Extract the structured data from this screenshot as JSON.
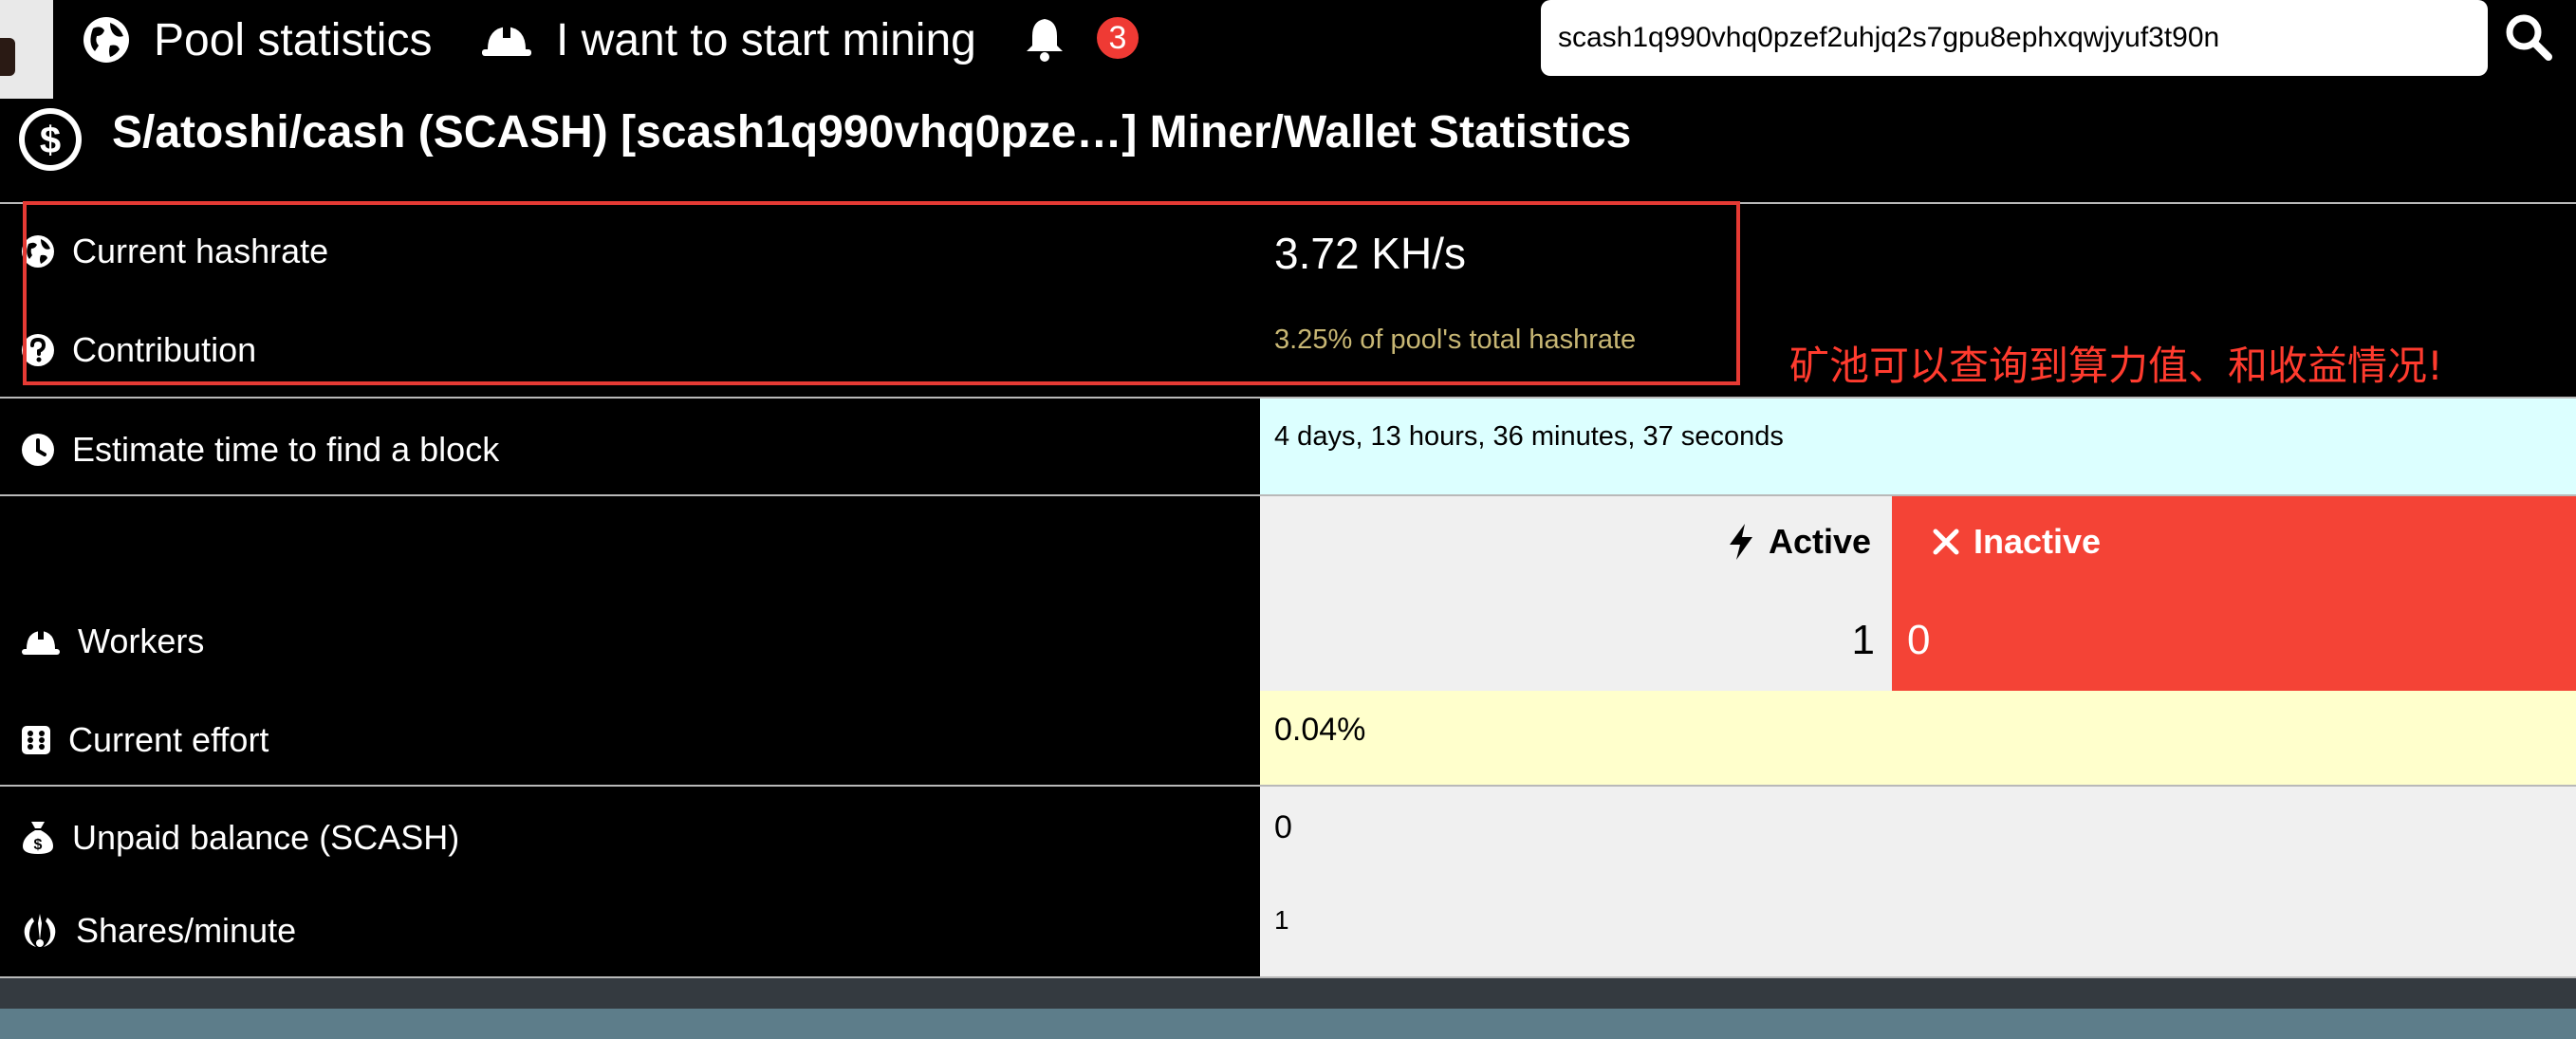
{
  "nav": {
    "pool_stats_label": "Pool statistics",
    "start_mining_label": "I want to start mining",
    "notification_count": "3"
  },
  "search": {
    "value": "scash1q990vhq0pzef2uhjq2s7gpu8ephxqwjyuf3t90n"
  },
  "page": {
    "title": "S/atoshi/cash (SCASH) [scash1q990vhq0pze…] Miner/Wallet Statistics"
  },
  "stats": {
    "hashrate": {
      "label": "Current hashrate",
      "value": "3.72 KH/s"
    },
    "contribution": {
      "label": "Contribution",
      "value": "3.25% of pool's total hashrate"
    },
    "estimate": {
      "label": "Estimate time to find a block",
      "value": "4 days, 13 hours, 36 minutes, 37 seconds"
    },
    "workers": {
      "label": "Workers",
      "active_label": "Active",
      "inactive_label": "Inactive",
      "active_count": "1",
      "inactive_count": "0"
    },
    "effort": {
      "label": "Current effort",
      "value": "0.04%"
    },
    "balance": {
      "label": "Unpaid balance (SCASH)",
      "value": "0"
    },
    "shares": {
      "label": "Shares/minute",
      "value": "1"
    }
  },
  "annotation": "矿池可以查询到算力值、和收益情况!",
  "colors": {
    "background": "#000000",
    "highlight_border": "#e53a34",
    "annotation_text": "#ff3b2e",
    "contribution_text": "#c8b774",
    "estimate_bg": "#dcffff",
    "active_bg": "#f0f0f0",
    "inactive_bg": "#f44336",
    "effort_bg": "#ffffcc",
    "balance_bg": "#f0f0f0",
    "footer_dark": "#343a40",
    "footer_teal": "#5d7d8a"
  },
  "icons": {
    "pool": "globe-icon",
    "mining": "hard-hat-icon",
    "notifications": "bell-icon",
    "search": "search-icon",
    "title": "dollar-coin-icon",
    "hashrate": "globe-icon",
    "contribution": "question-circle-icon",
    "estimate": "clock-icon",
    "workers": "hard-hat-icon",
    "effort": "dice-icon",
    "balance": "money-bag-icon",
    "shares": "jedi-order-icon",
    "active": "bolt-icon",
    "inactive": "times-icon"
  }
}
